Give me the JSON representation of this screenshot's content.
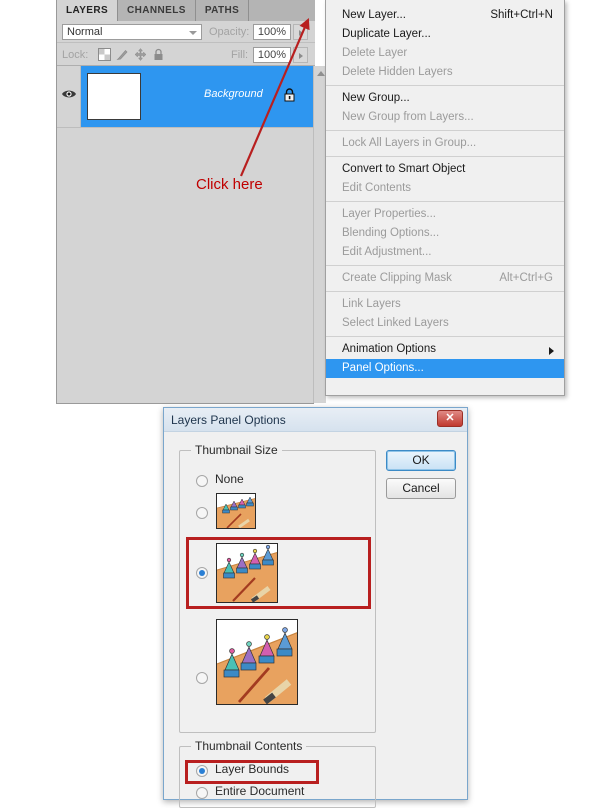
{
  "panel": {
    "tabs": [
      {
        "label": "LAYERS",
        "active": true
      },
      {
        "label": "CHANNELS",
        "active": false
      },
      {
        "label": "PATHS",
        "active": false
      }
    ],
    "menu_icon": "panel-menu-icon",
    "blend_mode": "Normal",
    "opacity_label": "Opacity:",
    "opacity_value": "100%",
    "lock_label": "Lock:",
    "lock_icons": [
      "lock-transparent-pixels-icon",
      "lock-image-pixels-icon",
      "lock-position-icon",
      "lock-all-icon"
    ],
    "fill_label": "Fill:",
    "fill_value": "100%",
    "layers": [
      {
        "name": "Background",
        "visible": true,
        "locked": true,
        "selected": true
      }
    ]
  },
  "annotation": {
    "click_here": "Click here",
    "color": "#c00000"
  },
  "flyout_menu": {
    "items": [
      {
        "label": "New Layer...",
        "shortcut": "Shift+Ctrl+N",
        "state": "enabled"
      },
      {
        "label": "Duplicate Layer...",
        "shortcut": "",
        "state": "enabled"
      },
      {
        "label": "Delete Layer",
        "shortcut": "",
        "state": "disabled"
      },
      {
        "label": "Delete Hidden Layers",
        "shortcut": "",
        "state": "disabled"
      },
      {
        "separator": true
      },
      {
        "label": "New Group...",
        "shortcut": "",
        "state": "enabled"
      },
      {
        "label": "New Group from Layers...",
        "shortcut": "",
        "state": "disabled"
      },
      {
        "separator": true
      },
      {
        "label": "Lock All Layers in Group...",
        "shortcut": "",
        "state": "disabled"
      },
      {
        "separator": true
      },
      {
        "label": "Convert to Smart Object",
        "shortcut": "",
        "state": "enabled"
      },
      {
        "label": "Edit Contents",
        "shortcut": "",
        "state": "disabled"
      },
      {
        "separator": true
      },
      {
        "label": "Layer Properties...",
        "shortcut": "",
        "state": "disabled"
      },
      {
        "label": "Blending Options...",
        "shortcut": "",
        "state": "disabled"
      },
      {
        "label": "Edit Adjustment...",
        "shortcut": "",
        "state": "disabled"
      },
      {
        "separator": true
      },
      {
        "label": "Create Clipping Mask",
        "shortcut": "Alt+Ctrl+G",
        "state": "disabled"
      },
      {
        "separator": true
      },
      {
        "label": "Link Layers",
        "shortcut": "",
        "state": "disabled"
      },
      {
        "label": "Select Linked Layers",
        "shortcut": "",
        "state": "disabled"
      },
      {
        "separator": true
      },
      {
        "label": "Animation Options",
        "shortcut": "",
        "state": "enabled",
        "submenu": true
      },
      {
        "label": "Panel Options...",
        "shortcut": "",
        "state": "selected"
      }
    ]
  },
  "dialog": {
    "title": "Layers Panel Options",
    "close_label": "✕",
    "ok_label": "OK",
    "cancel_label": "Cancel",
    "thumbnail_size": {
      "title": "Thumbnail Size",
      "options": [
        {
          "label": "None",
          "checked": false,
          "has_thumb": false
        },
        {
          "label": "",
          "checked": false,
          "has_thumb": true,
          "thumb_size": "small",
          "highlighted": false
        },
        {
          "label": "",
          "checked": true,
          "has_thumb": true,
          "thumb_size": "medium",
          "highlighted": true
        },
        {
          "label": "",
          "checked": false,
          "has_thumb": true,
          "thumb_size": "large",
          "highlighted": false
        }
      ]
    },
    "thumbnail_contents": {
      "title": "Thumbnail Contents",
      "options": [
        {
          "label": "Layer Bounds",
          "checked": true,
          "highlighted": true
        },
        {
          "label": "Entire Document",
          "checked": false,
          "highlighted": false
        }
      ]
    }
  }
}
